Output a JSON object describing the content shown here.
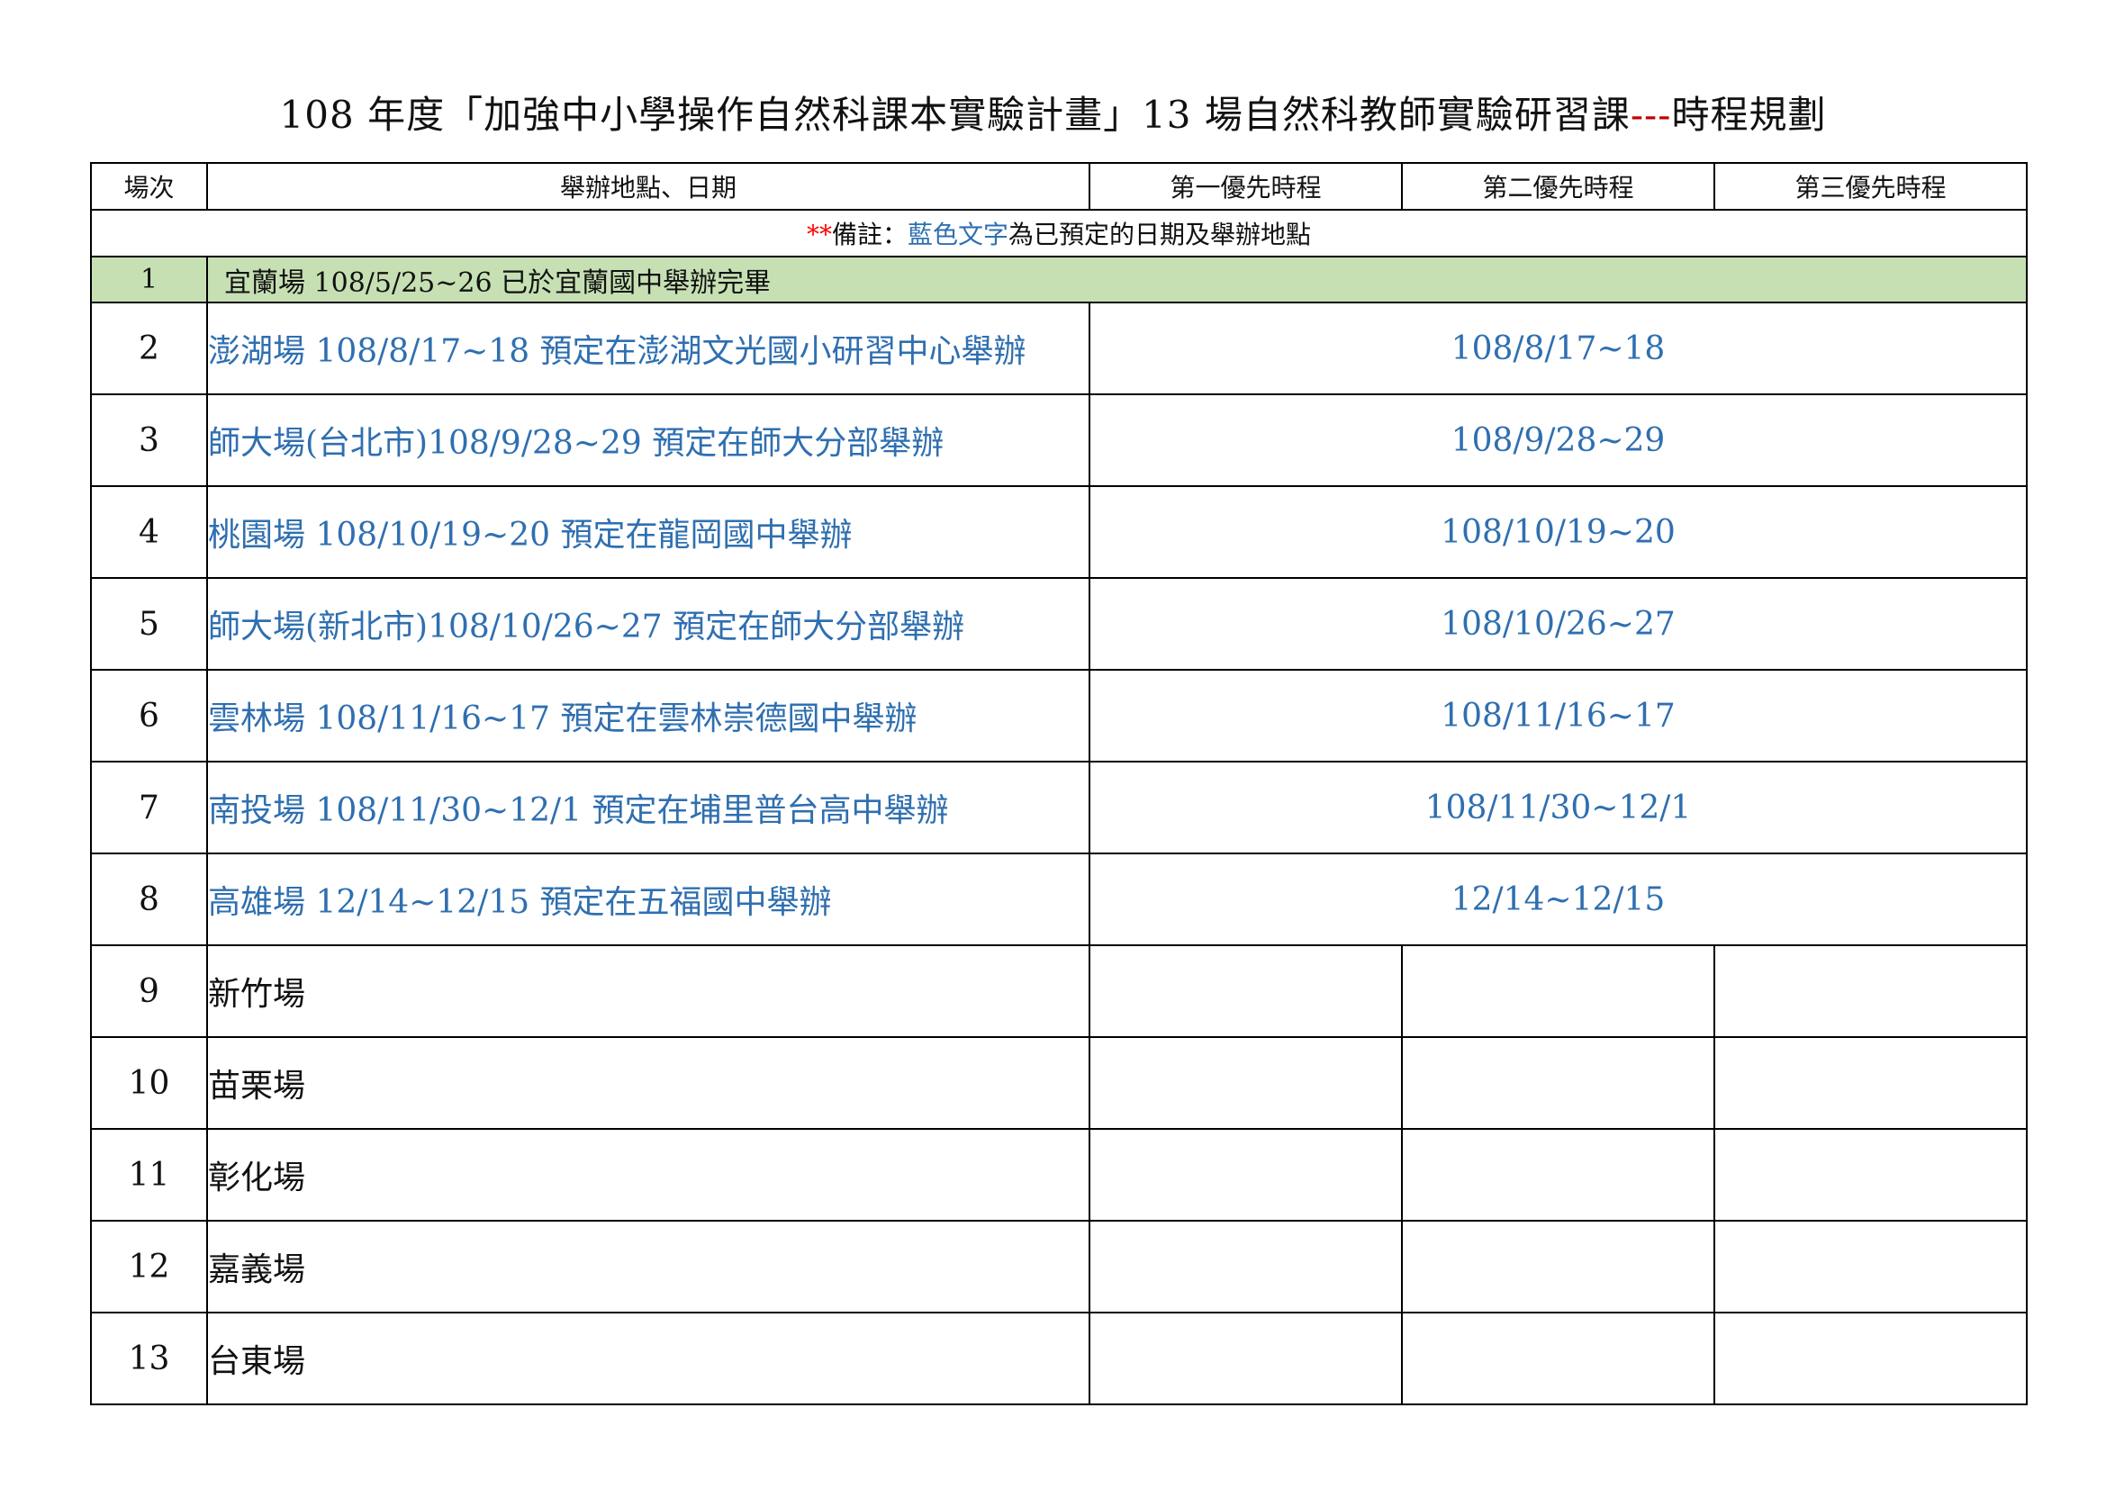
{
  "title": {
    "main": "108 年度「加強中小學操作自然科課本實驗計畫」13 場自然科教師實驗研習課",
    "dashes": "---",
    "suffix": "時程規劃"
  },
  "table": {
    "headers": [
      "場次",
      "舉辦地點、日期",
      "第一優先時程",
      "第二優先時程",
      "第三優先時程"
    ],
    "note": {
      "stars": "**",
      "prefix": "備註：",
      "blue": "藍色文字",
      "suffix": "為已預定的日期及舉辦地點"
    },
    "completed_row": {
      "no": "1",
      "location": "宜蘭場 108/5/25~26 已於宜蘭國中舉辦完畢"
    },
    "scheduled_rows": [
      {
        "no": "2",
        "location": "澎湖場 108/8/17~18 預定在澎湖文光國小研習中心舉辦",
        "date": "108/8/17~18"
      },
      {
        "no": "3",
        "location": "師大場(台北市)108/9/28~29 預定在師大分部舉辦",
        "date": "108/9/28~29"
      },
      {
        "no": "4",
        "location": "桃園場 108/10/19~20 預定在龍岡國中舉辦",
        "date": "108/10/19~20"
      },
      {
        "no": "5",
        "location": "師大場(新北市)108/10/26~27 預定在師大分部舉辦",
        "date": "108/10/26~27"
      },
      {
        "no": "6",
        "location": "雲林場 108/11/16~17 預定在雲林崇德國中舉辦",
        "date": "108/11/16~17"
      },
      {
        "no": "7",
        "location": "南投場 108/11/30~12/1 預定在埔里普台高中舉辦",
        "date": "108/11/30~12/1"
      },
      {
        "no": "8",
        "location": "高雄場 12/14~12/15 預定在五福國中舉辦",
        "date": "12/14~12/15"
      }
    ],
    "open_rows": [
      {
        "no": "9",
        "location": "新竹場",
        "p1": "",
        "p2": "",
        "p3": ""
      },
      {
        "no": "10",
        "location": "苗栗場",
        "p1": "",
        "p2": "",
        "p3": ""
      },
      {
        "no": "11",
        "location": "彰化場",
        "p1": "",
        "p2": "",
        "p3": ""
      },
      {
        "no": "12",
        "location": "嘉義場",
        "p1": "",
        "p2": "",
        "p3": ""
      },
      {
        "no": "13",
        "location": "台東場",
        "p1": "",
        "p2": "",
        "p3": ""
      }
    ]
  },
  "colors": {
    "blue_text": "#2f6fb0",
    "note_stars": "#ff0000",
    "completed_row_bg": "#c6e0b4",
    "border": "#000000"
  }
}
